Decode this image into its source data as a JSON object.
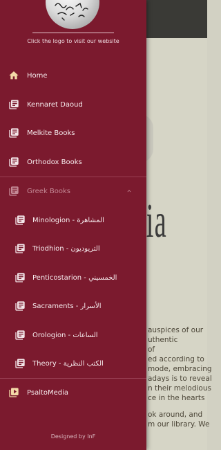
{
  "background": {
    "big_text": "lia",
    "paragraph_lines": [
      "auspices of our",
      "uthentic",
      "of",
      "ed according to",
      "mode, embracing",
      "adays is to reveal",
      "n their melodious",
      "ce in the hearts"
    ],
    "paragraph2_lines": [
      "ok around, and",
      "m our library. We"
    ]
  },
  "drawer": {
    "logo_caption": "Click the logo to visit our website",
    "items": [
      {
        "label": "Home",
        "icon": "home-icon"
      },
      {
        "label": "Kennaret Daoud",
        "icon": "library-books-icon"
      },
      {
        "label": "Melkite Books",
        "icon": "library-books-icon"
      },
      {
        "label": "Orthodox Books",
        "icon": "library-books-icon"
      }
    ],
    "group": {
      "label": "Greek Books",
      "icon": "library-books-icon",
      "expanded": true
    },
    "sub_items": [
      {
        "label": "Minologion - المشاهرة"
      },
      {
        "label": "Triodhion - التريوديون"
      },
      {
        "label": "Penticostarion - الخمسيني"
      },
      {
        "label": "Sacraments - الأسرار"
      },
      {
        "label": "Orologion - الساعات"
      },
      {
        "label": "Theory - الكتب النظرية"
      }
    ],
    "media_item": {
      "label": "PsaltoMedia",
      "icon": "play-media-icon"
    },
    "footer": "Designed by InF"
  },
  "colors": {
    "drawer_bg": "#7b1a2e",
    "text": "#f6ecee",
    "dim_text": "#c48a96"
  }
}
